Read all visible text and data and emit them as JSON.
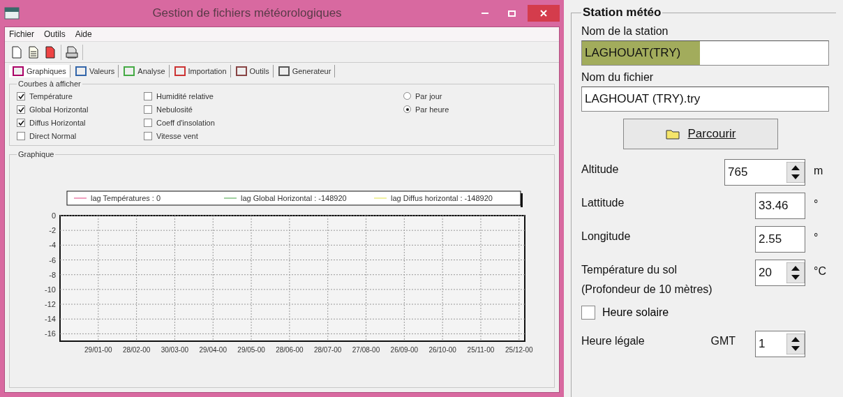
{
  "window": {
    "title": "Gestion de fichiers météorologiques"
  },
  "menu": [
    "Fichier",
    "Outils",
    "Aide"
  ],
  "toolbar": [
    {
      "kind": "new"
    },
    {
      "kind": "open"
    },
    {
      "kind": "export"
    },
    {
      "kind": "print"
    }
  ],
  "tabs": [
    {
      "label": "Graphiques",
      "kind": "chart",
      "selected": true
    },
    {
      "label": "Valeurs",
      "kind": "table",
      "selected": false
    },
    {
      "label": "Analyse",
      "kind": "analysis",
      "selected": false
    },
    {
      "label": "Importation",
      "kind": "import",
      "selected": false
    },
    {
      "label": "Outils",
      "kind": "tools",
      "selected": false
    },
    {
      "label": "Generateur",
      "kind": "generator",
      "selected": false
    }
  ],
  "curves": {
    "title": "Courbes à afficher",
    "columns": [
      [
        {
          "label": "Température",
          "checked": true
        },
        {
          "label": "Global Horizontal",
          "checked": true
        },
        {
          "label": "Diffus Horizontal",
          "checked": true
        },
        {
          "label": "Direct Normal",
          "checked": false
        }
      ],
      [
        {
          "label": "Humidité relative",
          "checked": false
        },
        {
          "label": "Nebulosité",
          "checked": false
        },
        {
          "label": "Coeff d'insolation",
          "checked": false
        },
        {
          "label": "Vitesse vent",
          "checked": false
        }
      ]
    ],
    "periods": [
      {
        "label": "Par jour",
        "selected": false
      },
      {
        "label": "Par heure",
        "selected": true
      }
    ]
  },
  "graph": {
    "title": "Graphique",
    "chart_data": {
      "type": "line",
      "categories": [
        "29/01-00",
        "28/02-00",
        "30/03-00",
        "29/04-00",
        "29/05-00",
        "28/06-00",
        "28/07-00",
        "27/08-00",
        "26/09-00",
        "26/10-00",
        "25/11-00",
        "25/12-00"
      ],
      "ylim": [
        -17,
        0
      ],
      "grid": true,
      "yticks": [
        0,
        -2,
        -4,
        -6,
        -8,
        -10,
        -12,
        -14,
        -16
      ],
      "series": [
        {
          "name": "lag Températures : 0",
          "color": "#f0a0c0",
          "values": [
            null,
            null,
            null,
            null,
            null,
            null,
            null,
            null,
            null,
            null,
            null,
            null
          ]
        },
        {
          "name": "lag Global Horizontal : -148920",
          "color": "#a0d0a0",
          "values": [
            null,
            null,
            null,
            null,
            null,
            null,
            null,
            null,
            null,
            null,
            null,
            null
          ]
        },
        {
          "name": "lag Diffus horizontal : -148920",
          "color": "#f0f0a0",
          "values": [
            null,
            null,
            null,
            null,
            null,
            null,
            null,
            null,
            null,
            null,
            null,
            null
          ]
        }
      ]
    }
  },
  "station": {
    "title": "Station météo",
    "name_label": "Nom de la station",
    "name_value": "LAGHOUAT(TRY)",
    "file_label": "Nom du fichier",
    "file_value": "LAGHOUAT (TRY).try",
    "browse": "Parcourir",
    "params": [
      {
        "label": "Altitude",
        "value": "765",
        "unit": "m",
        "kind": "spin",
        "wide": true
      },
      {
        "label": "Lattitude",
        "value": "33.46",
        "unit": "°",
        "kind": "text"
      },
      {
        "label": "Longitude",
        "value": "2.55",
        "unit": "°",
        "kind": "text"
      },
      {
        "label": "Température du sol",
        "note": "(Profondeur de 10 mètres)",
        "value": "20",
        "unit": "°C",
        "kind": "spin"
      }
    ],
    "solar": {
      "label": "Heure solaire",
      "checked": false
    },
    "legal": {
      "label": "Heure légale",
      "gmt": "GMT",
      "value": "1"
    }
  }
}
